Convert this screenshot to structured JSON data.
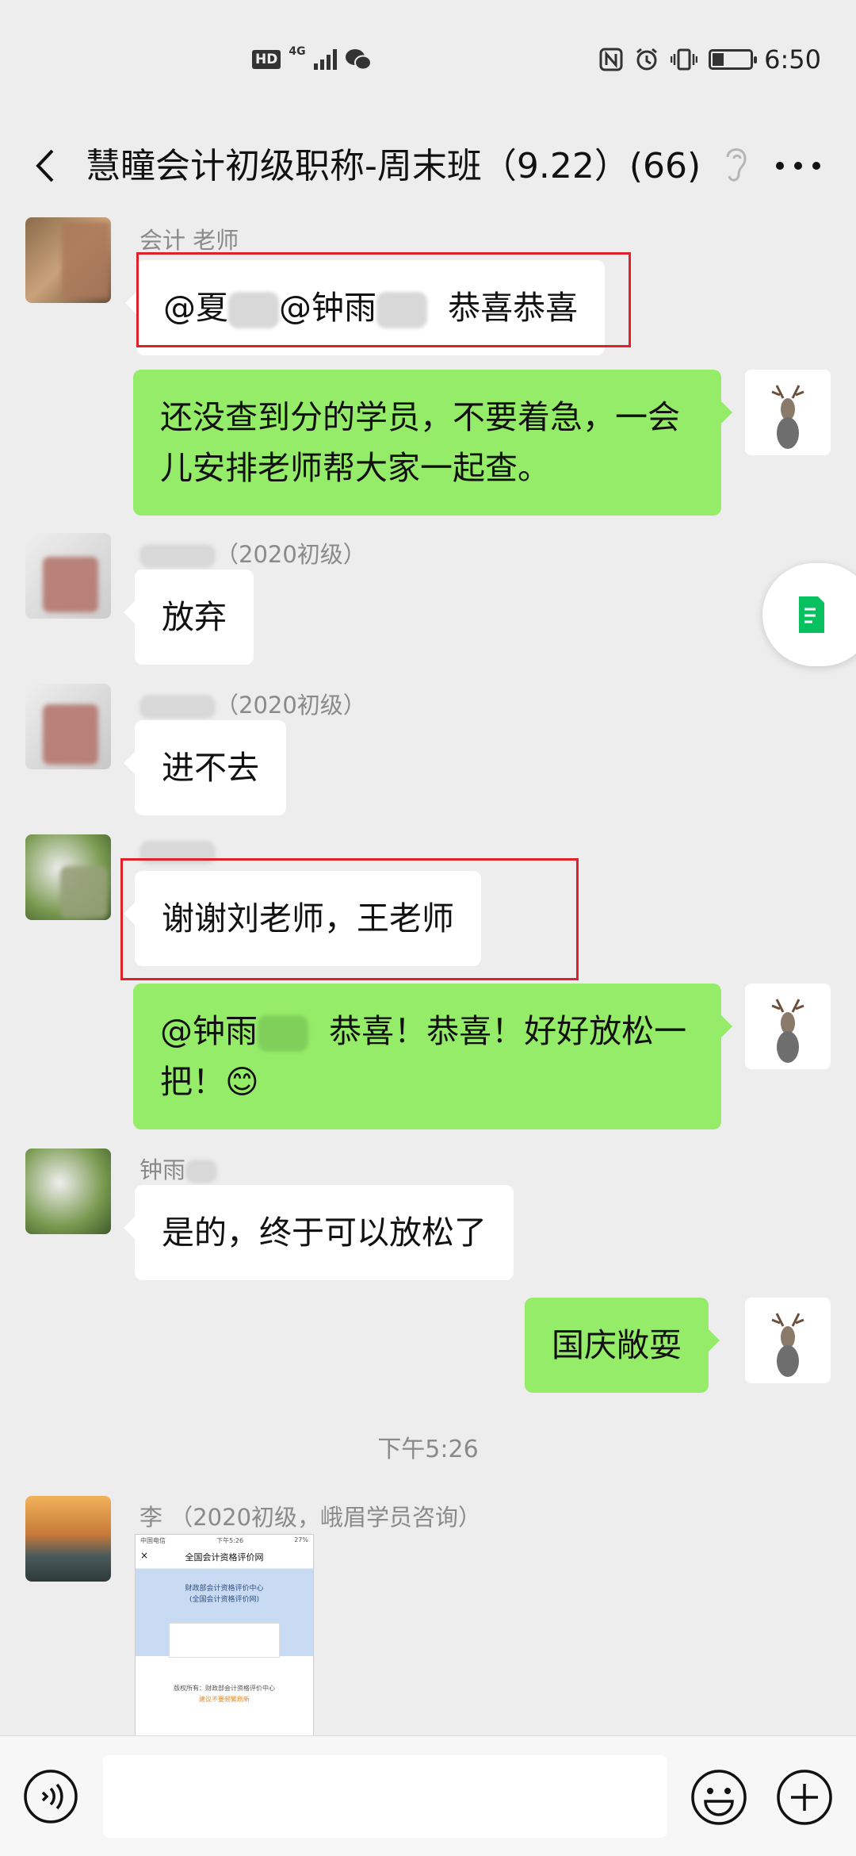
{
  "status_bar": {
    "hd": "HD",
    "network": "4G",
    "time": "6:50"
  },
  "header": {
    "title": "慧瞳会计初级职称-周末班（9.22）(66)"
  },
  "messages": [
    {
      "sender": "会计    老师",
      "text_prefix": "@夏",
      "text_mid": "@钟雨",
      "text_suffix": "恭喜恭喜"
    },
    {
      "text": "还没查到分的学员，不要着急，一会儿安排老师帮大家一起查。"
    },
    {
      "sender": "（2020初级）",
      "text": "放弃"
    },
    {
      "sender": "（2020初级）",
      "text": "进不去"
    },
    {
      "text": "谢谢刘老师，王老师"
    },
    {
      "text_prefix": "@钟雨",
      "text_suffix": "恭喜！恭喜！好好放松一把！😊"
    },
    {
      "sender": "钟雨",
      "text": "是的，终于可以放松了"
    },
    {
      "text": "国庆敞耍"
    },
    {
      "sender": "李  （2020初级，峨眉学员咨询）"
    }
  ],
  "timestamp": "下午5:26",
  "preview": {
    "carrier": "中国电信",
    "time": "下午5:26",
    "battery": "27%",
    "title": "全国会计资格评价网",
    "band_line1": "财政部会计资格评价中心",
    "band_line2": "(全国会计资格评价网)",
    "foot_line1": "版权所有：财政部会计资格评价中心",
    "foot_line2": "建议不要频繁刷新"
  },
  "input": {
    "placeholder": ""
  },
  "colors": {
    "outgoing": "#95ec69",
    "incoming": "#ffffff",
    "highlight_box": "#e0202a",
    "background": "#ededed"
  }
}
